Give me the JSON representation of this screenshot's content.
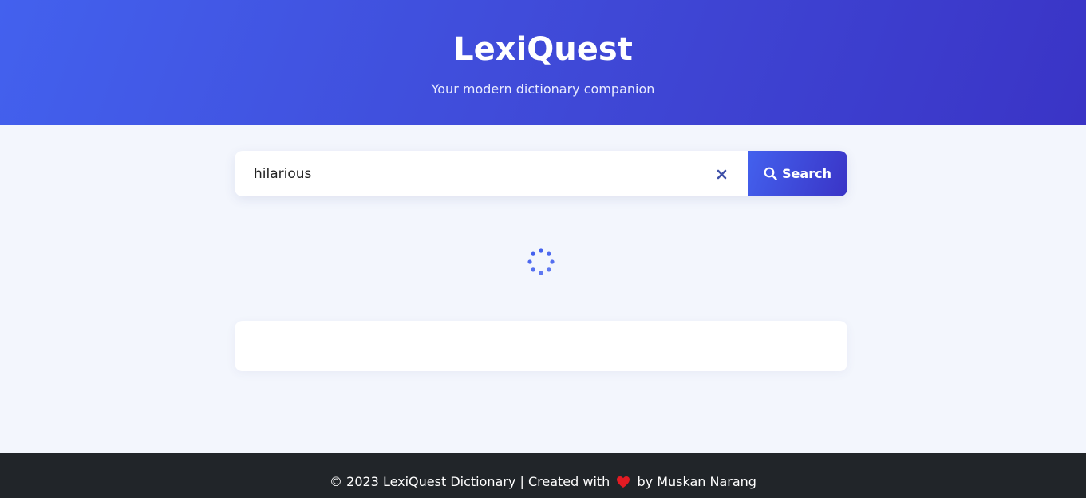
{
  "header": {
    "title": "LexiQuest",
    "subtitle": "Your modern dictionary companion"
  },
  "search": {
    "value": "hilarious",
    "button_label": "Search"
  },
  "footer": {
    "text_before": "© 2023 LexiQuest Dictionary | Created with",
    "text_after": "by Muskan Narang",
    "heart_icon": "heart-icon"
  },
  "colors": {
    "accent": "#4361ee",
    "accent_dark": "#3a34c6",
    "background": "#f3f6fd",
    "footer_bg": "#212529",
    "heart": "#e31b23"
  }
}
